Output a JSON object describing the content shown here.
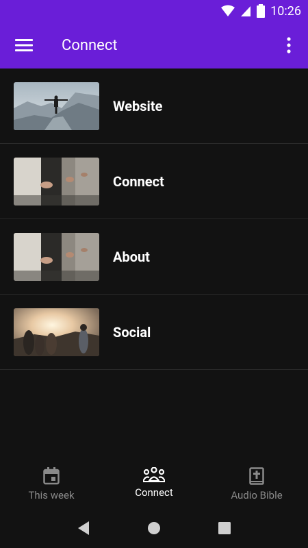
{
  "status": {
    "time": "10:26",
    "icons": [
      "wifi-icon",
      "cell-signal-icon",
      "battery-icon"
    ]
  },
  "appbar": {
    "title": "Connect",
    "menu_icon": "hamburger-menu-icon",
    "more_icon": "more-vertical-icon"
  },
  "colors": {
    "accent": "#6a1ed8",
    "background": "#121212",
    "divider": "#2a2a2a",
    "nav_inactive": "#8a8a8a"
  },
  "list": {
    "items": [
      {
        "label": "Website",
        "thumbnail": "person-on-mountain-photo"
      },
      {
        "label": "Connect",
        "thumbnail": "people-with-phones-photo"
      },
      {
        "label": "About",
        "thumbnail": "people-with-phones-photo"
      },
      {
        "label": "Social",
        "thumbnail": "friends-at-sunset-photo"
      }
    ]
  },
  "bottom_nav": {
    "items": [
      {
        "label": "This week",
        "icon": "calendar-icon",
        "active": false
      },
      {
        "label": "Connect",
        "icon": "people-group-icon",
        "active": true
      },
      {
        "label": "Audio Bible",
        "icon": "bible-icon",
        "active": false
      }
    ]
  },
  "system_nav": {
    "icons": [
      "back-icon",
      "home-icon",
      "recents-icon"
    ]
  }
}
